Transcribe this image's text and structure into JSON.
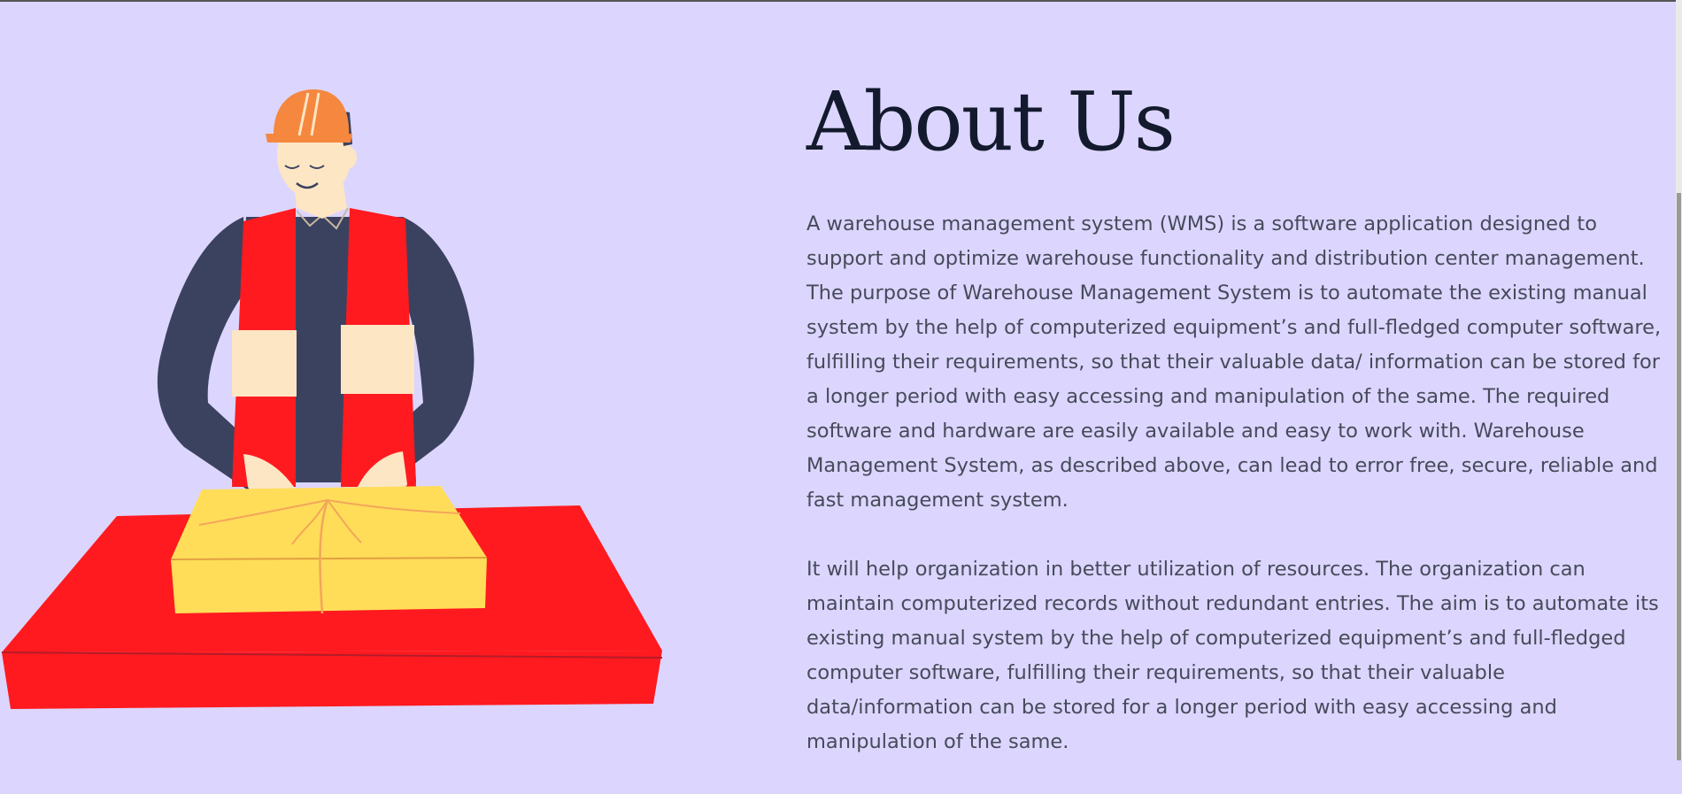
{
  "about": {
    "title": "About Us",
    "paragraph_1": "A warehouse management system (WMS) is a software application designed to support and optimize warehouse functionality and distribution center management. The purpose of Warehouse Management System is to automate the existing manual system by the help of computerized equipment’s and full-fledged computer software, fulfilling their requirements, so that their valuable data/ information can be stored for a longer period with easy accessing and manipulation of the same. The required software and hardware are easily available and easy to work with. Warehouse Management System, as described above, can lead to error free, secure, reliable and fast management system.",
    "paragraph_2": "It will help organization in better utilization of resources. The organization can maintain computerized records without redundant entries. The aim is to automate its existing manual system by the help of computerized equipment’s and full-fledged computer software, fulfilling their requirements, so that their valuable data/information can be stored for a longer period with easy accessing and manipulation of the same."
  },
  "illustration": {
    "icon": "worker-packing-box-illustration",
    "colors": {
      "background": "#dcd6ff",
      "helmet": "#f5873f",
      "vest": "#ff1a1f",
      "shirt": "#3b4260",
      "skin": "#fde6c4",
      "box": "#ffdd59",
      "twine": "#f3a65b"
    }
  },
  "scrollbar": {
    "icon": "vertical-scrollbar"
  }
}
